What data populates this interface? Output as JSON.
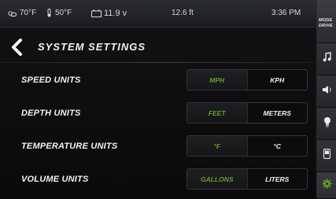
{
  "status_bar": {
    "air_temp": "70°F",
    "water_temp": "50°F",
    "battery": "11.9 v",
    "depth": "12.6 ft",
    "time": "3:36 PM"
  },
  "header": {
    "title": "SYSTEM SETTINGS"
  },
  "settings": {
    "speed": {
      "label": "SPEED UNITS",
      "selected": "MPH",
      "other": "KPH"
    },
    "depth": {
      "label": "DEPTH UNITS",
      "selected": "FEET",
      "other": "METERS"
    },
    "temperature": {
      "label": "TEMPERATURE UNITS",
      "selected": "°F",
      "other": "°C"
    },
    "volume": {
      "label": "VOLUME UNITS",
      "selected": "GALLONS",
      "other": "LITERS"
    }
  },
  "sidebar": {
    "mode_line1": "MODE",
    "mode_line2": "DRIVE",
    "items": [
      "music-icon",
      "volume-icon",
      "light-bulb-icon",
      "phone-icon",
      "settings-gear-icon"
    ]
  },
  "colors": {
    "accent": "#6d9a2c",
    "background": "#0b0b0c",
    "text": "#f2f2f2"
  }
}
